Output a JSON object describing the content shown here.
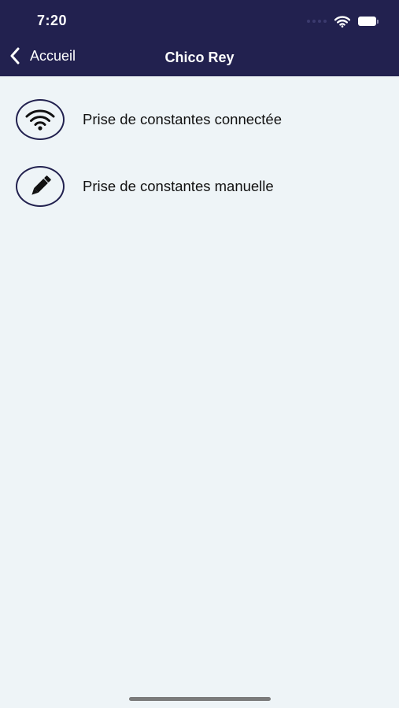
{
  "status_bar": {
    "time": "7:20",
    "icons": [
      "cellular-dots-icon",
      "wifi-icon",
      "battery-icon"
    ]
  },
  "nav": {
    "back_label": "Accueil",
    "back_icon": "chevron-left-icon",
    "title": "Chico Rey"
  },
  "menu": {
    "items": [
      {
        "label": "Prise de constantes connectée",
        "icon": "wifi-icon"
      },
      {
        "label": "Prise de constantes manuelle",
        "icon": "pencil-icon"
      }
    ]
  },
  "colors": {
    "header_bg": "#22214f",
    "page_bg": "#eef4f7",
    "icon_ring": "#22214f",
    "text": "#111111"
  }
}
